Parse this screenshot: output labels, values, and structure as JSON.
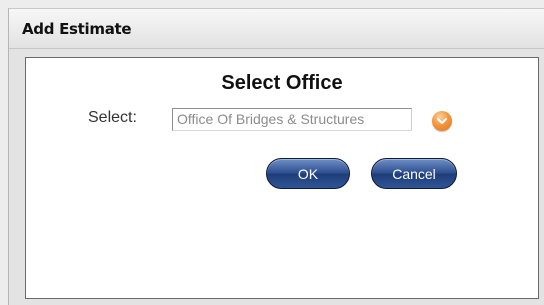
{
  "dialog": {
    "title": "Add Estimate",
    "heading": "Select Office",
    "select_label": "Select:",
    "select_value": "Office Of Bridges & Structures",
    "ok_label": "OK",
    "cancel_label": "Cancel"
  },
  "icons": {
    "dropdown": "chevron-down-icon"
  },
  "colors": {
    "button": "#2e4f8f",
    "dropdown": "#f08a2c"
  }
}
